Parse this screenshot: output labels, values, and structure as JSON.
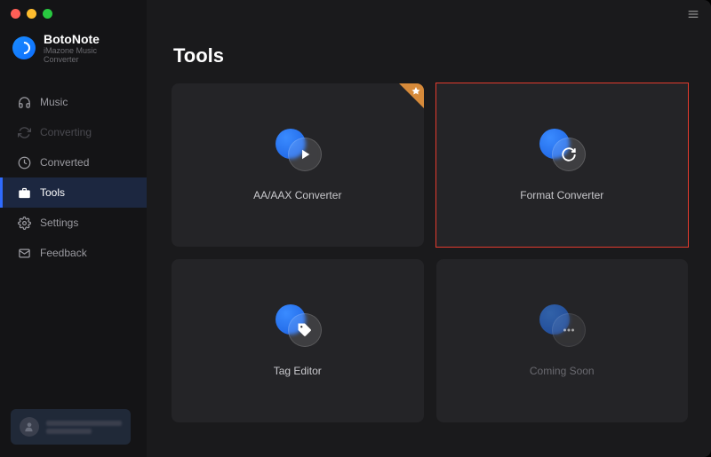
{
  "brand": {
    "title": "BotoNote",
    "subtitle": "iMazone Music Converter"
  },
  "sidebar": {
    "items": [
      {
        "label": "Music"
      },
      {
        "label": "Converting"
      },
      {
        "label": "Converted"
      },
      {
        "label": "Tools"
      },
      {
        "label": "Settings"
      },
      {
        "label": "Feedback"
      }
    ]
  },
  "page": {
    "title": "Tools"
  },
  "tools": [
    {
      "label": "AA/AAX Converter",
      "icon": "play"
    },
    {
      "label": "Format Converter",
      "icon": "refresh"
    },
    {
      "label": "Tag Editor",
      "icon": "tag"
    },
    {
      "label": "Coming Soon",
      "icon": "dots"
    }
  ],
  "colors": {
    "accent": "#2f6bff",
    "highlight_border": "#e23b2e"
  }
}
